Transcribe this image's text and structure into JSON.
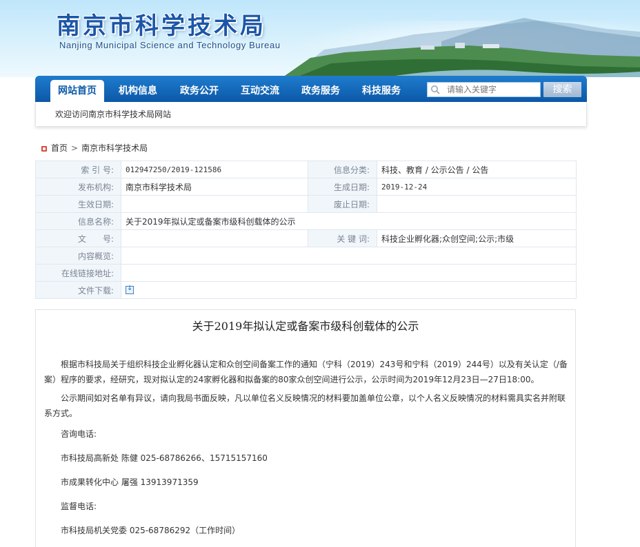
{
  "header": {
    "title": "南京市科学技术局",
    "subtitle": "Nanjing Municipal Science and Technology Bureau"
  },
  "nav": {
    "items": [
      {
        "label": "网站首页",
        "active": true
      },
      {
        "label": "机构信息"
      },
      {
        "label": "政务公开"
      },
      {
        "label": "互动交流"
      },
      {
        "label": "政务服务"
      },
      {
        "label": "科技服务"
      }
    ],
    "search_placeholder": "请输入关键字",
    "search_button": "搜索"
  },
  "welcome": "欢迎访问南京市科学技术局网站",
  "breadcrumb": {
    "home": "首页",
    "separator": ">",
    "current": "南京市科学技术局"
  },
  "info": {
    "index_label": "索 引 号:",
    "index_value": "012947250/2019-121586",
    "category_label": "信息分类:",
    "category_value": "科技、教育 / 公示公告 / 公告",
    "publisher_label": "发布机构:",
    "publisher_value": "南京市科学技术局",
    "created_label": "生成日期:",
    "created_value": "2019-12-24",
    "effective_label": "生效日期:",
    "effective_value": "",
    "expired_label": "废止日期:",
    "expired_value": "",
    "name_label": "信息名称:",
    "name_value": "关于2019年拟认定或备案市级科创载体的公示",
    "docno_label": "文　　号:",
    "docno_value": "",
    "keywords_label": "关 键 词:",
    "keywords_value": "科技企业孵化器;众创空间;公示;市级",
    "summary_label": "内容概览:",
    "summary_value": "",
    "link_label": "在线链接地址:",
    "link_value": "",
    "download_label": "文件下载:",
    "download_icon": "download-icon"
  },
  "article": {
    "title": "关于2019年拟认定或备案市级科创载体的公示",
    "p1_line1": "根据市科技局关于组织科技企业孵化器认定和众创空间备案工作的通知（宁科（2019）243号和宁科（2019）244号）以及有关认定（/备",
    "p1_line2": "案）程序的要求，经研究，现对拟认定的24家孵化器和拟备案的80家众创空间进行公示，公示时间为2019年12月23日—27日18:00。",
    "p2_line1": "公示期间如对名单有异议，请向我局书面反映，凡以单位名义反映情况的材料要加盖单位公章，以个人名义反映情况的材料需具实名并附联",
    "p2_line2": "系方式。",
    "consult_label": "咨询电话:",
    "contact1": "市科技局高新处  陈健  025-68786266、15715157160",
    "contact2": "市成果转化中心  屠强  13913971359",
    "supervise_label": "监督电话:",
    "contact3": "市科技局机关党委    025-68786292（工作时间）"
  },
  "colors": {
    "nav_blue": "#0c58a8",
    "title_blue": "#1b56a8",
    "label_bg": "#f1f6fb"
  }
}
